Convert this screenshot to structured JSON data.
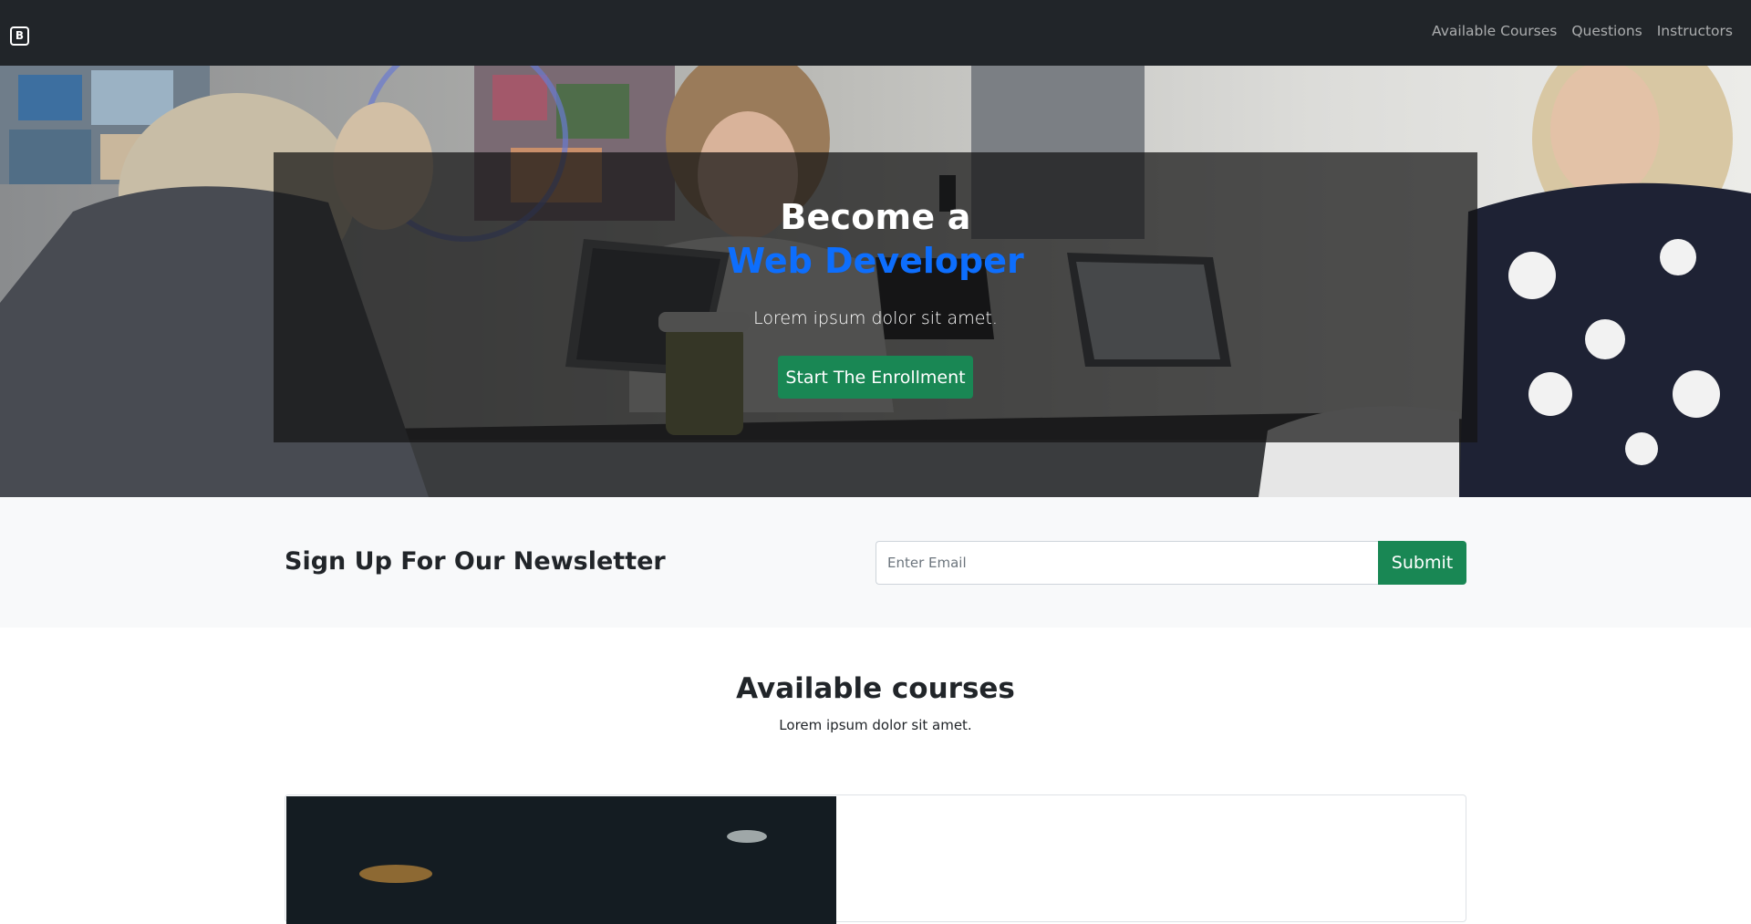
{
  "navbar": {
    "brand_icon": "bootstrap-logo-icon",
    "brand_glyph": "B",
    "links": [
      {
        "label": "Available Courses"
      },
      {
        "label": "Questions"
      },
      {
        "label": "Instructors"
      }
    ]
  },
  "hero": {
    "title_line1": "Become a",
    "title_line2": "Web Developer",
    "lead": "Lorem ipsum dolor sit amet.",
    "cta_label": "Start The Enrollment",
    "accent_color": "#0d6efd",
    "cta_color": "#198754"
  },
  "newsletter": {
    "title": "Sign Up For Our Newsletter",
    "email_placeholder": "Enter Email",
    "submit_label": "Submit"
  },
  "courses": {
    "title": "Available courses",
    "subtitle": "Lorem ipsum dolor sit amet."
  }
}
